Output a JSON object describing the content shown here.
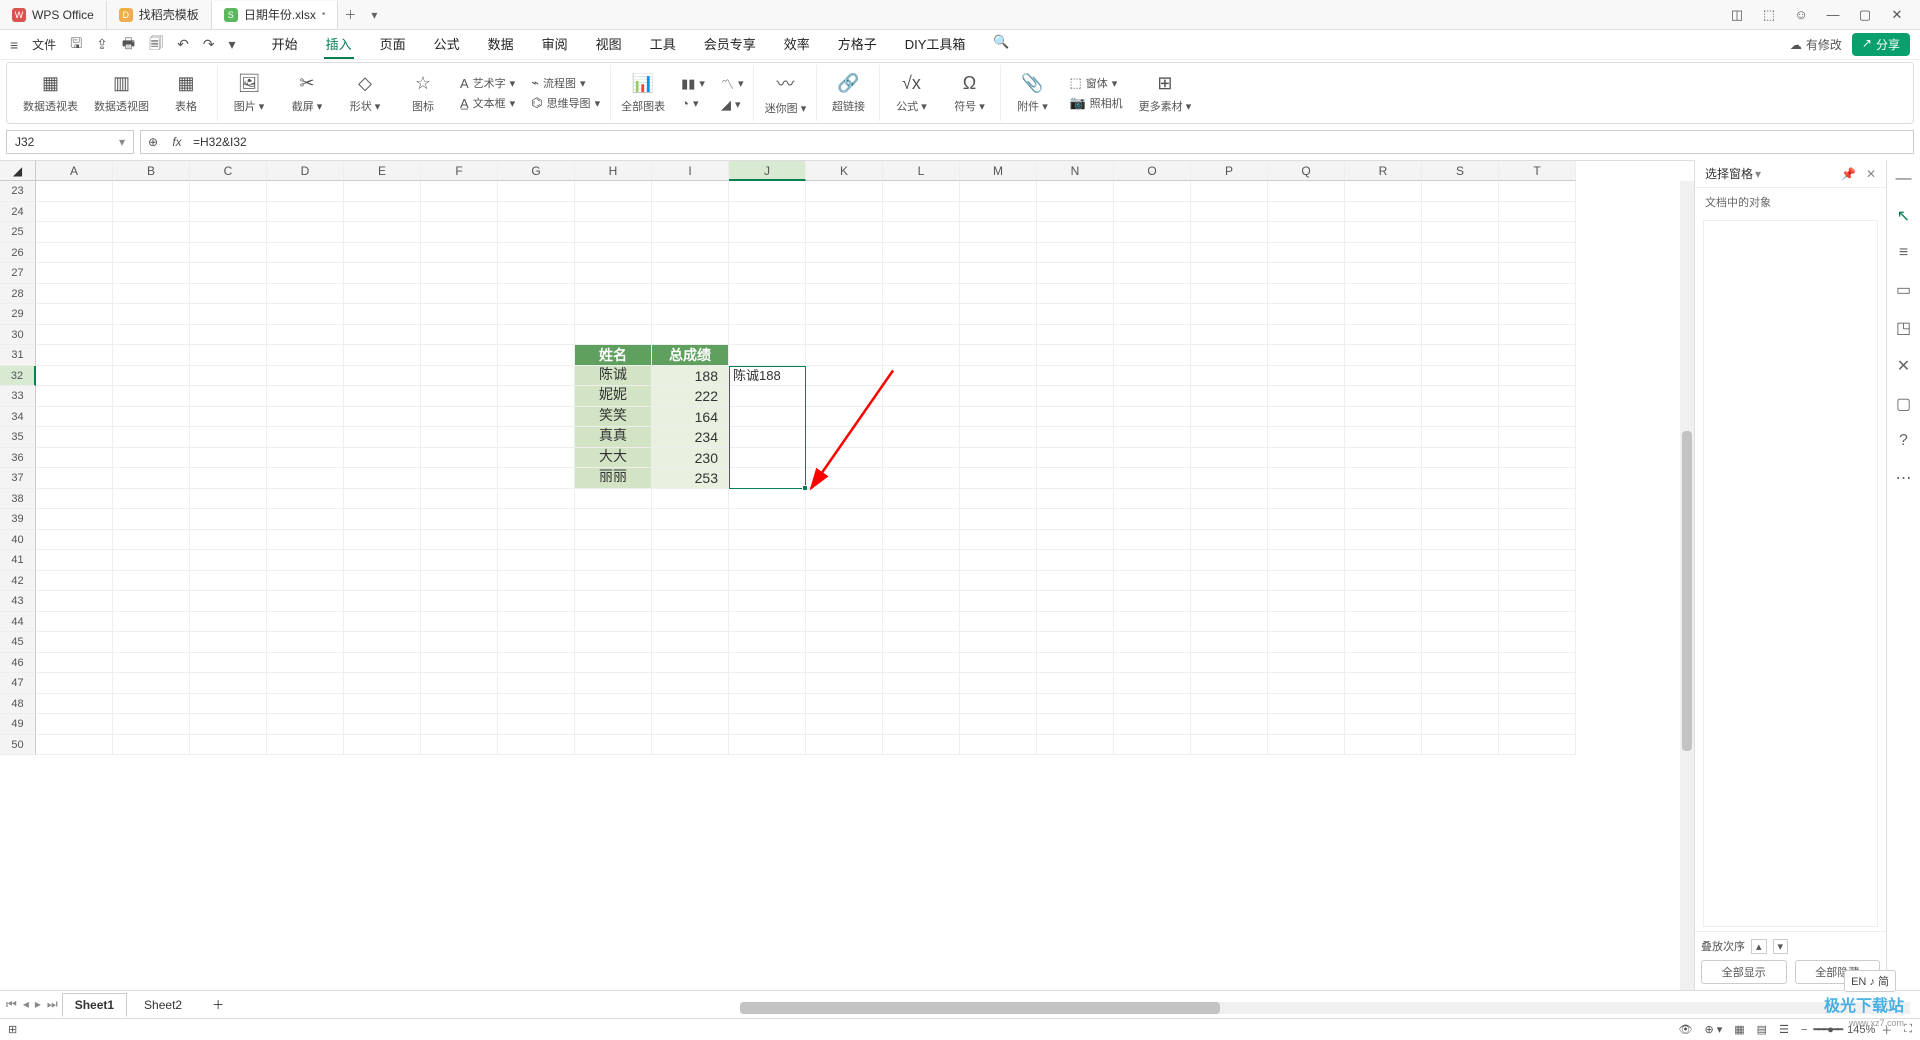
{
  "tabs": [
    {
      "badge": "W",
      "badgeClass": "badge-red",
      "label": "WPS Office"
    },
    {
      "badge": "D",
      "badgeClass": "badge-orange",
      "label": "找稻壳模板"
    },
    {
      "badge": "S",
      "badgeClass": "badge-green",
      "label": "日期年份.xlsx",
      "dirty": "•"
    }
  ],
  "quick": {
    "file": "文件"
  },
  "menus": [
    "开始",
    "插入",
    "页面",
    "公式",
    "数据",
    "审阅",
    "视图",
    "工具",
    "会员专享",
    "效率",
    "方格子",
    "DIY工具箱"
  ],
  "activeMenu": "插入",
  "rightquick": {
    "revise": "有修改",
    "share": "分享"
  },
  "ribbon": {
    "g1": [
      {
        "l": "数据透视表"
      },
      {
        "l": "数据透视图"
      },
      {
        "l": "表格"
      }
    ],
    "g2": [
      {
        "l": "图片"
      },
      {
        "l": "截屏"
      },
      {
        "l": "形状"
      },
      {
        "l": "图标"
      }
    ],
    "g2s": [
      {
        "l": "艺术字"
      },
      {
        "l": "文本框"
      }
    ],
    "g2s2": [
      {
        "l": "流程图"
      },
      {
        "l": "思维导图"
      }
    ],
    "g3": [
      {
        "l": "全部图表"
      }
    ],
    "g4": [
      {
        "l": "迷你图"
      }
    ],
    "g5": [
      {
        "l": "超链接"
      }
    ],
    "g6": [
      {
        "l": "公式"
      },
      {
        "l": "符号"
      }
    ],
    "g7": [
      {
        "l": "附件"
      },
      {
        "l": "照相机"
      },
      {
        "l": "更多素材"
      }
    ],
    "g7s": [
      {
        "l": "窗体"
      }
    ]
  },
  "namebox": "J32",
  "formula": "=H32&I32",
  "columns": [
    "A",
    "B",
    "C",
    "D",
    "E",
    "F",
    "G",
    "H",
    "I",
    "J",
    "K",
    "L",
    "M",
    "N",
    "O",
    "P",
    "Q",
    "R",
    "S",
    "T"
  ],
  "rowStart": 23,
  "rowEnd": 50,
  "selCol": "J",
  "selRow": 32,
  "table": {
    "header": [
      "姓名",
      "总成绩"
    ],
    "rows": [
      {
        "n": "陈诚",
        "v": "188"
      },
      {
        "n": "妮妮",
        "v": "222"
      },
      {
        "n": "笑笑",
        "v": "164"
      },
      {
        "n": "真真",
        "v": "234"
      },
      {
        "n": "大大",
        "v": "230"
      },
      {
        "n": "丽丽",
        "v": "253"
      }
    ],
    "resultCell": "陈诚188"
  },
  "rpanel": {
    "title": "选择窗格",
    "sub": "文档中的对象",
    "order": "叠放次序",
    "showAll": "全部显示",
    "hideAll": "全部隐藏"
  },
  "sheets": [
    "Sheet1",
    "Sheet2"
  ],
  "status": {
    "zoom": "145%",
    "ime": "EN ♪ 简"
  },
  "watermark": {
    "main": "极光下载站",
    "sub": "www.xz7.com"
  }
}
